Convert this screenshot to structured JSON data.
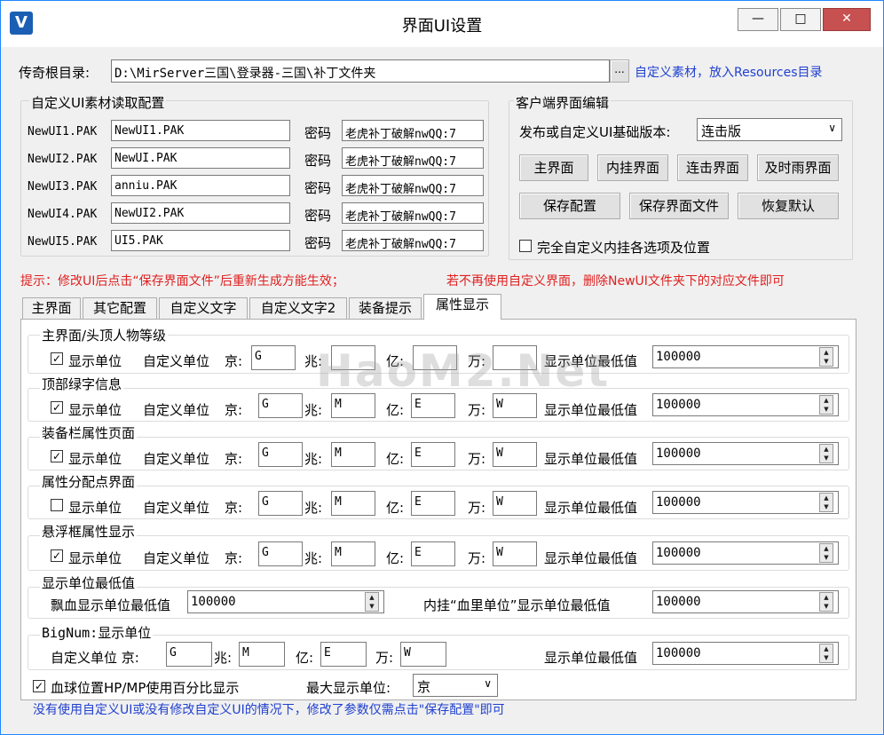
{
  "window": {
    "title": "界面UI设置",
    "minimize": "—",
    "maximize": "□",
    "close": "✕"
  },
  "root_dir": {
    "label": "传奇根目录:",
    "value": "D:\\MirServer三国\\登录器-三国\\补丁文件夹",
    "browse": "...",
    "hint": "自定义素材，放入Resources目录"
  },
  "custom_ui": {
    "title": "自定义UI素材读取配置",
    "password_label": "密码",
    "rows": [
      {
        "label": "NewUI1.PAK",
        "value": "NewUI1.PAK",
        "password": "老虎补丁破解nwQQ:7"
      },
      {
        "label": "NewUI2.PAK",
        "value": "NewUI.PAK",
        "password": "老虎补丁破解nwQQ:7"
      },
      {
        "label": "NewUI3.PAK",
        "value": "anniu.PAK",
        "password": "老虎补丁破解nwQQ:7"
      },
      {
        "label": "NewUI4.PAK",
        "value": "NewUI2.PAK",
        "password": "老虎补丁破解nwQQ:7"
      },
      {
        "label": "NewUI5.PAK",
        "value": "UI5.PAK",
        "password": "老虎补丁破解nwQQ:7"
      }
    ]
  },
  "client_ui": {
    "title": "客户端界面编辑",
    "version_label": "发布或自定义UI基础版本:",
    "version_value": "连击版",
    "buttons_row1": [
      "主界面",
      "内挂界面",
      "连击界面",
      "及时雨界面"
    ],
    "buttons_row2": [
      "保存配置",
      "保存界面文件",
      "恢复默认"
    ],
    "full_custom": "完全自定义内挂各选项及位置"
  },
  "notice": {
    "left": "提示：修改UI后点击“保存界面文件”后重新生成方能生效；",
    "right": "若不再使用自定义界面，删除NewUI文件夹下的对应文件即可"
  },
  "tabs": [
    "主界面",
    "其它配置",
    "自定义文字",
    "自定义文字2",
    "装备提示",
    "属性显示"
  ],
  "attr": {
    "show_unit": "显示单位",
    "custom_unit": "自定义单位",
    "jing": "京:",
    "zhao": "兆:",
    "yi": "亿:",
    "wan": "万:",
    "min_label": "显示单位最低值",
    "sections": [
      {
        "title": "主界面/头顶人物等级",
        "checked": "✓",
        "jing": "G",
        "zhao": "",
        "yi": "",
        "wan": "",
        "min": "100000"
      },
      {
        "title": "顶部绿字信息",
        "checked": "✓",
        "jing": "G",
        "zhao": "M",
        "yi": "E",
        "wan": "W",
        "min": "100000"
      },
      {
        "title": "装备栏属性页面",
        "checked": "✓",
        "jing": "G",
        "zhao": "M",
        "yi": "E",
        "wan": "W",
        "min": "100000"
      },
      {
        "title": "属性分配点界面",
        "checked": "",
        "jing": "G",
        "zhao": "M",
        "yi": "E",
        "wan": "W",
        "min": "100000"
      },
      {
        "title": "悬浮框属性显示",
        "checked": "✓",
        "jing": "G",
        "zhao": "M",
        "yi": "E",
        "wan": "W",
        "min": "100000"
      }
    ],
    "min_section": {
      "title": "显示单位最低值",
      "blood_label": "飘血显示单位最低值",
      "blood_value": "100000",
      "hp_label": "内挂“血里单位”显示单位最低值",
      "hp_value": "100000"
    },
    "bignum": {
      "title": "BigNum:显示单位",
      "custom_unit": "自定义单位 京:",
      "jing": "G",
      "zhao": "M",
      "yi": "E",
      "wan": "W",
      "min_label": "显示单位最低值",
      "min_value": "100000"
    },
    "percent": {
      "checked": "✓",
      "label": "血球位置HP/MP使用百分比显示"
    },
    "max_unit": {
      "label": "最大显示单位:",
      "value": "京"
    },
    "footer": "没有使用自定义UI或没有修改自定义UI的情况下，修改了参数仅需点击\"保存配置\"即可"
  },
  "watermark": "HaoM2.Net"
}
